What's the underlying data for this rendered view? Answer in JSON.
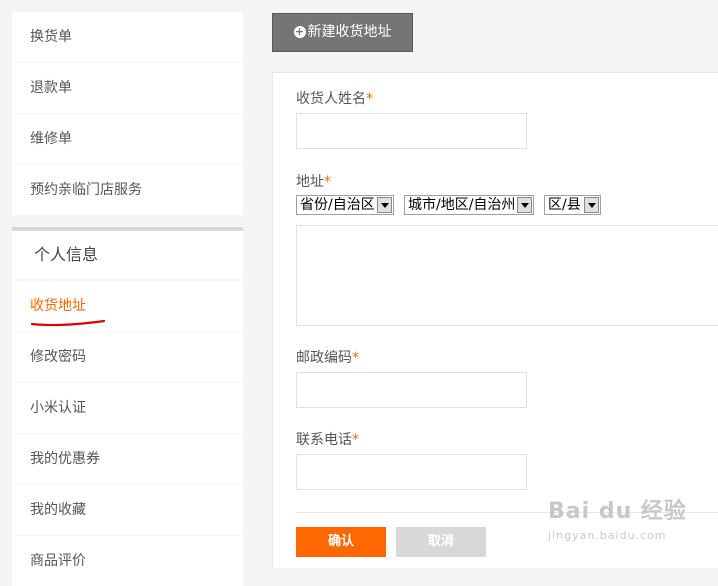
{
  "sidebar": {
    "items_top": [
      {
        "label": "换货单"
      },
      {
        "label": "退款单"
      },
      {
        "label": "维修单"
      },
      {
        "label": "预约亲临门店服务"
      }
    ],
    "section_title": "个人信息",
    "items_bottom": [
      {
        "label": "收货地址",
        "active": true
      },
      {
        "label": "修改密码"
      },
      {
        "label": "小米认证"
      },
      {
        "label": "我的优惠券"
      },
      {
        "label": "我的收藏"
      },
      {
        "label": "商品评价"
      }
    ]
  },
  "toolbar": {
    "new_address_label": "新建收货地址",
    "plus_icon": "+"
  },
  "form": {
    "required_mark": "*",
    "name": {
      "label": "收货人姓名",
      "value": ""
    },
    "address": {
      "label": "地址",
      "province": "省份/自治区",
      "city": "城市/地区/自治州",
      "district": "区/县",
      "detail": ""
    },
    "zip": {
      "label": "邮政编码",
      "value": ""
    },
    "phone": {
      "label": "联系电话",
      "value": ""
    },
    "confirm_label": "确认",
    "cancel_label": "取消"
  },
  "watermark": {
    "brand": "Bai du 经验",
    "url": "jingyan.baidu.com"
  },
  "colors": {
    "accent": "#ff6700",
    "button_dark": "#757575"
  }
}
